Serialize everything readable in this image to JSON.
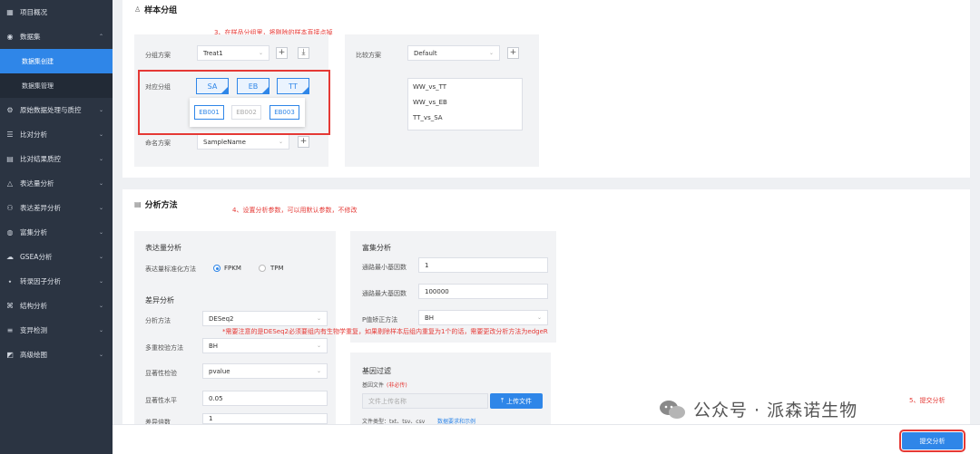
{
  "sidebar": {
    "items": [
      {
        "label": "项目概况",
        "icon": "grid-icon"
      },
      {
        "label": "数据集",
        "icon": "database-icon",
        "chev": "⌃"
      },
      {
        "label": "数据集创建",
        "sub": true,
        "active": true
      },
      {
        "label": "数据集管理",
        "sub": true
      },
      {
        "label": "原始数据处理与质控",
        "icon": "filter-icon",
        "chev": "⌄"
      },
      {
        "label": "比对分析",
        "icon": "list-icon",
        "chev": "⌄"
      },
      {
        "label": "比对结果质控",
        "icon": "document-icon",
        "chev": "⌄"
      },
      {
        "label": "表达量分析",
        "icon": "triangle-icon",
        "chev": "⌄"
      },
      {
        "label": "表达差异分析",
        "icon": "circles-icon",
        "chev": "⌄"
      },
      {
        "label": "富集分析",
        "icon": "globe-icon",
        "chev": "⌄"
      },
      {
        "label": "GSEA分析",
        "icon": "cloud-icon",
        "chev": "⌄"
      },
      {
        "label": "转录因子分析",
        "icon": "tag-icon",
        "chev": "⌄"
      },
      {
        "label": "结构分析",
        "icon": "structure-icon",
        "chev": "⌄"
      },
      {
        "label": "变异检测",
        "icon": "menu-icon",
        "chev": "⌄"
      },
      {
        "label": "高级绘图",
        "icon": "chart-icon",
        "chev": "⌄"
      }
    ]
  },
  "grouping": {
    "title": "样本分组",
    "annotation": "3、在样品分组里，将剔除的样本直接点掉",
    "group_scheme_label": "分组方案",
    "group_scheme_value": "Treat1",
    "compare_scheme_label": "比较方案",
    "compare_scheme_value": "Default",
    "group_label": "对应分组",
    "groups": [
      "SA",
      "EB",
      "TT"
    ],
    "samples": [
      {
        "name": "EB001",
        "selected": true
      },
      {
        "name": "EB002",
        "selected": false
      },
      {
        "name": "EB003",
        "selected": true
      }
    ],
    "naming_label": "命名方案",
    "naming_value": "SampleName",
    "comparisons": [
      "WW_vs_TT",
      "WW_vs_EB",
      "TT_vs_SA"
    ],
    "plus": "+",
    "download": "⤓"
  },
  "analysis": {
    "title": "分析方法",
    "annotation": "4、设置分析参数，可以用默认参数，不修改",
    "expr_title": "表达量分析",
    "norm_label": "表达量标准化方法",
    "norm_options": [
      "FPKM",
      "TPM"
    ],
    "diff_title": "差异分析",
    "method_label": "分析方法",
    "method_value": "DESeq2",
    "multi_label": "多重校验方法",
    "multi_value": "BH",
    "sig_label": "显著性检验",
    "sig_value": "pvalue",
    "level_label": "显著性水平",
    "level_value": "0.05",
    "fold_label": "差异倍数",
    "fold_value": "1",
    "note": "*需要注意的是DESeq2必须要组内有生物学重复，如果剔除样本后组内重复为1个的话，需要更改分析方法为edgeR",
    "enrich_title": "富集分析",
    "min_label": "通路最小基因数",
    "min_value": "1",
    "max_label": "通路最大基因数",
    "max_value": "100000",
    "padj_label": "P值矫正方法",
    "padj_value": "BH",
    "filter_title": "基因过滤",
    "file_label": "基因文件",
    "file_optional": "(非必传)",
    "file_placeholder": "文件上传名称",
    "upload_label": "上传文件",
    "filetypes": "文件类型：txt、tsv、csv",
    "sample_link": "数据要求和示例"
  },
  "footer": {
    "annotation": "5、提交分析",
    "submit_label": "提交分析",
    "watermark": "公众号 · 派森诺生物"
  },
  "colors": {
    "accent": "#2f86e8",
    "annotation": "#e53935",
    "sidebar": "#2b3442"
  }
}
